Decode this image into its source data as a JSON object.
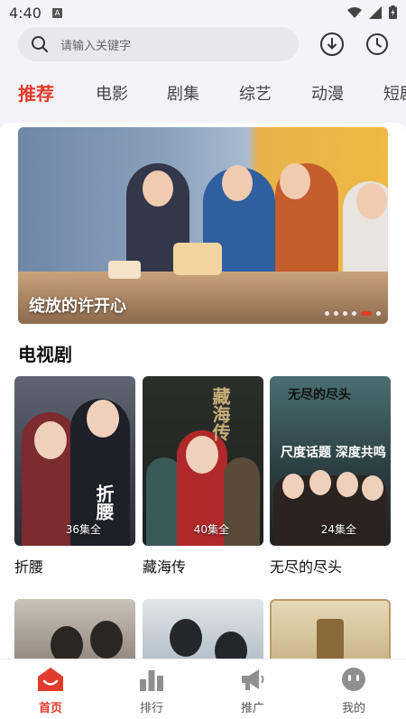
{
  "status_bar": {
    "time": "4:40",
    "notification_letter": "A"
  },
  "search": {
    "placeholder": "请输入关键字"
  },
  "tabs": [
    {
      "label": "推荐",
      "active": true
    },
    {
      "label": "电影"
    },
    {
      "label": "剧集"
    },
    {
      "label": "综艺"
    },
    {
      "label": "动漫"
    },
    {
      "label": "短剧"
    }
  ],
  "banner": {
    "caption": "绽放的许开心",
    "dots": 6,
    "active_dot": 5
  },
  "section": {
    "title": "电视剧"
  },
  "dramas": [
    {
      "name": "折腰",
      "badge": "36集全",
      "poster_title": "折腰"
    },
    {
      "name": "藏海传",
      "badge": "40集全",
      "poster_title": "藏海传"
    },
    {
      "name": "无尽的尽头",
      "badge": "24集全",
      "poster_title": "无尽的尽头",
      "poster_tagline": "尺度话题 深度共鸣"
    }
  ],
  "bottom_nav": [
    {
      "label": "首页",
      "icon": "home-icon",
      "active": true
    },
    {
      "label": "排行",
      "icon": "bar-chart-icon"
    },
    {
      "label": "推广",
      "icon": "megaphone-icon"
    },
    {
      "label": "我的",
      "icon": "profile-face-icon"
    }
  ],
  "colors": {
    "accent": "#e23a2c",
    "background": "#f4f3f8"
  }
}
